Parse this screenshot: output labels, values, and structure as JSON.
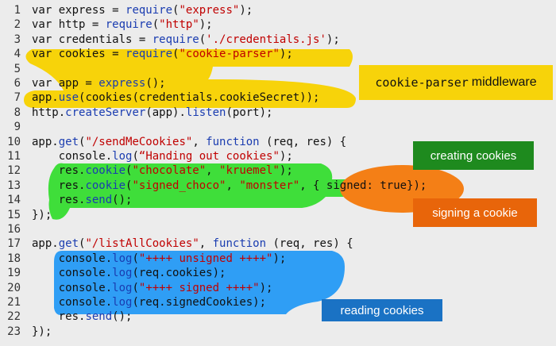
{
  "code_lines": [
    {
      "n": "1",
      "segs": [
        {
          "t": "var express = "
        },
        {
          "t": "require",
          "c": "fn"
        },
        {
          "t": "("
        },
        {
          "t": "\"express\"",
          "c": "str"
        },
        {
          "t": ");"
        }
      ]
    },
    {
      "n": "2",
      "segs": [
        {
          "t": "var http = "
        },
        {
          "t": "require",
          "c": "fn"
        },
        {
          "t": "("
        },
        {
          "t": "\"http\"",
          "c": "str"
        },
        {
          "t": ");"
        }
      ]
    },
    {
      "n": "3",
      "segs": [
        {
          "t": "var credentials = "
        },
        {
          "t": "require",
          "c": "fn"
        },
        {
          "t": "("
        },
        {
          "t": "'./credentials.js'",
          "c": "str"
        },
        {
          "t": ");"
        }
      ]
    },
    {
      "n": "4",
      "segs": [
        {
          "t": "var cookies = "
        },
        {
          "t": "require",
          "c": "fn"
        },
        {
          "t": "("
        },
        {
          "t": "\"cookie-parser\"",
          "c": "str"
        },
        {
          "t": ");"
        }
      ]
    },
    {
      "n": "5",
      "segs": []
    },
    {
      "n": "6",
      "segs": [
        {
          "t": "var app = "
        },
        {
          "t": "express",
          "c": "fn"
        },
        {
          "t": "();"
        }
      ]
    },
    {
      "n": "7",
      "segs": [
        {
          "t": "app."
        },
        {
          "t": "use",
          "c": "fn"
        },
        {
          "t": "(cookies(credentials.cookieSecret));"
        }
      ]
    },
    {
      "n": "8",
      "segs": [
        {
          "t": "http."
        },
        {
          "t": "createServer",
          "c": "fn"
        },
        {
          "t": "(app)."
        },
        {
          "t": "listen",
          "c": "fn"
        },
        {
          "t": "(port);"
        }
      ]
    },
    {
      "n": "9",
      "segs": []
    },
    {
      "n": "10",
      "segs": [
        {
          "t": "app."
        },
        {
          "t": "get",
          "c": "fn"
        },
        {
          "t": "("
        },
        {
          "t": "\"/sendMeCookies\"",
          "c": "str"
        },
        {
          "t": ", "
        },
        {
          "t": "function",
          "c": "fn"
        },
        {
          "t": " (req, res) {"
        }
      ]
    },
    {
      "n": "11",
      "segs": [
        {
          "t": "    console."
        },
        {
          "t": "log",
          "c": "fn"
        },
        {
          "t": "("
        },
        {
          "t": "“Handing out cookies\"",
          "c": "str"
        },
        {
          "t": ");"
        }
      ]
    },
    {
      "n": "12",
      "segs": [
        {
          "t": "    res."
        },
        {
          "t": "cookie",
          "c": "fn"
        },
        {
          "t": "("
        },
        {
          "t": "\"chocolate\"",
          "c": "str"
        },
        {
          "t": ", "
        },
        {
          "t": "\"kruemel\"",
          "c": "str"
        },
        {
          "t": ");"
        }
      ]
    },
    {
      "n": "13",
      "segs": [
        {
          "t": "    res."
        },
        {
          "t": "cookie",
          "c": "fn"
        },
        {
          "t": "("
        },
        {
          "t": "\"signed_choco\"",
          "c": "str"
        },
        {
          "t": ", "
        },
        {
          "t": "\"monster\"",
          "c": "str"
        },
        {
          "t": ", { signed: true});"
        }
      ]
    },
    {
      "n": "14",
      "segs": [
        {
          "t": "    res."
        },
        {
          "t": "send",
          "c": "fn"
        },
        {
          "t": "();"
        }
      ]
    },
    {
      "n": "15",
      "segs": [
        {
          "t": "});"
        }
      ]
    },
    {
      "n": "16",
      "segs": []
    },
    {
      "n": "17",
      "segs": [
        {
          "t": "app."
        },
        {
          "t": "get",
          "c": "fn"
        },
        {
          "t": "("
        },
        {
          "t": "\"/listAllCookies\"",
          "c": "str"
        },
        {
          "t": ", "
        },
        {
          "t": "function",
          "c": "fn"
        },
        {
          "t": " (req, res) {"
        }
      ]
    },
    {
      "n": "18",
      "segs": [
        {
          "t": "    console."
        },
        {
          "t": "log",
          "c": "fn"
        },
        {
          "t": "("
        },
        {
          "t": "\"++++ unsigned ++++\"",
          "c": "str"
        },
        {
          "t": ");"
        }
      ]
    },
    {
      "n": "19",
      "segs": [
        {
          "t": "    console."
        },
        {
          "t": "log",
          "c": "fn"
        },
        {
          "t": "(req.cookies);"
        }
      ]
    },
    {
      "n": "20",
      "segs": [
        {
          "t": "    console."
        },
        {
          "t": "log",
          "c": "fn"
        },
        {
          "t": "("
        },
        {
          "t": "\"++++ signed ++++\"",
          "c": "str"
        },
        {
          "t": ");"
        }
      ]
    },
    {
      "n": "21",
      "segs": [
        {
          "t": "    console."
        },
        {
          "t": "log",
          "c": "fn"
        },
        {
          "t": "(req.signedCookies);"
        }
      ]
    },
    {
      "n": "22",
      "segs": [
        {
          "t": "    res."
        },
        {
          "t": "send",
          "c": "fn"
        },
        {
          "t": "();"
        }
      ]
    },
    {
      "n": "23",
      "segs": [
        {
          "t": "});"
        }
      ]
    }
  ],
  "callouts": {
    "middleware_code": "cookie-parser",
    "middleware_text": "middleware",
    "creating": "creating cookies",
    "signing": "signing a cookie",
    "reading": "reading cookies"
  },
  "colors": {
    "yellow": "#f7d30a",
    "green": "#3fde3a",
    "orange": "#f47f16",
    "blue": "#2f9ef5",
    "creating_box": "#1e8a1e",
    "signing_box": "#e8650a",
    "reading_box": "#1a72c4",
    "fn": "#1a3cb0",
    "str": "#c00000"
  }
}
